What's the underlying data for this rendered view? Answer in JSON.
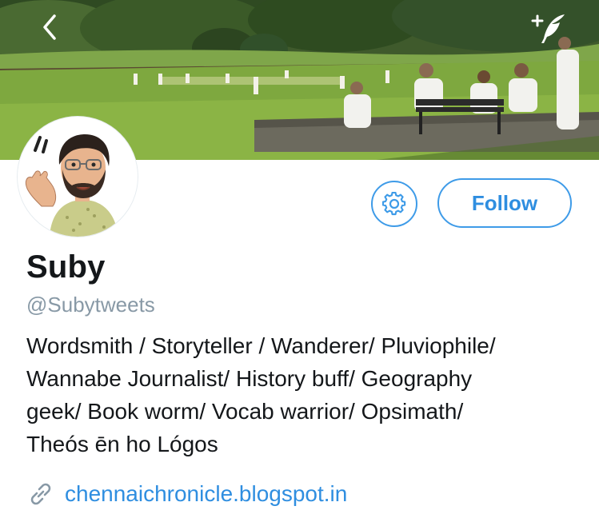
{
  "header": {
    "back_icon": "chevron-left-icon",
    "compose_icon": "quill-plus-icon"
  },
  "profile": {
    "name": "Suby",
    "handle": "@Subytweets",
    "bio_lines": [
      "Wordsmith / Storyteller / Wanderer/ Pluviophile/",
      "Wannabe Journalist/ History buff/ Geography",
      "geek/ Book worm/ Vocab warrior/ Opsimath/",
      "Theós ēn ho Lógos"
    ],
    "website": "chennaichronicle.blogspot.in",
    "website_icon": "link-icon"
  },
  "actions": {
    "settings_icon": "gear-icon",
    "follow_label": "Follow"
  },
  "colors": {
    "accent": "#2f8ee0",
    "handle_gray": "#8899a6",
    "text": "#14171a"
  }
}
